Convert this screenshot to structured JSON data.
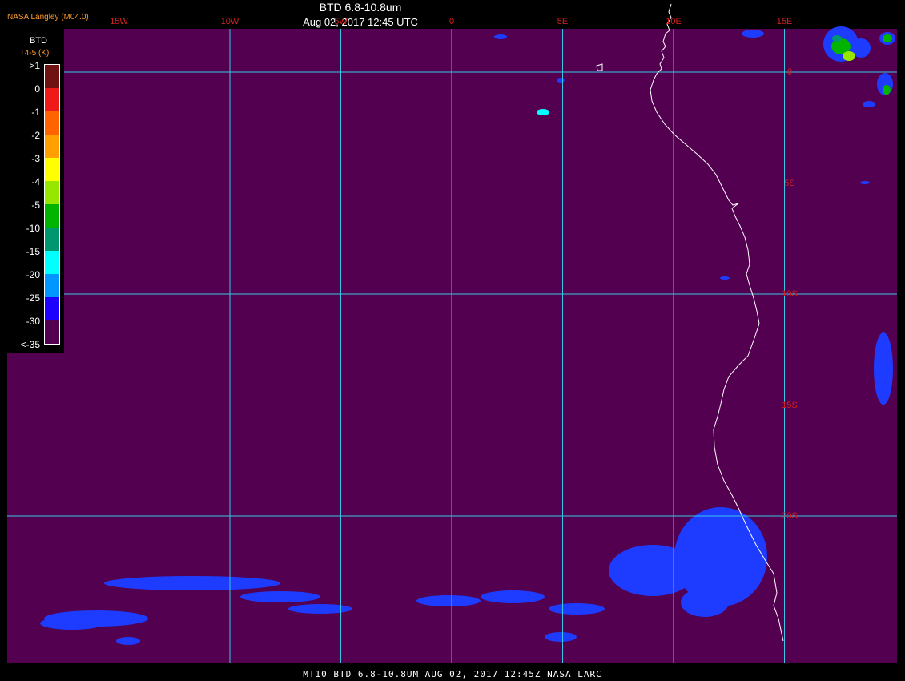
{
  "header": {
    "provider": "NASA Langley (M04.0)",
    "title": "BTD 6.8-10.8um",
    "subtitle": "Aug 02, 2017 12:45 UTC"
  },
  "footer": {
    "text": "MT10  BTD 6.8-10.8UM   AUG 02, 2017 12:45Z   NASA LARC"
  },
  "map": {
    "background_color": "#52004f",
    "grid_color": "#38c8e6",
    "coast_color": "#ffffff",
    "label_color": "#d02020",
    "lon_labels": [
      {
        "label": "15W",
        "value": -15
      },
      {
        "label": "10W",
        "value": -10
      },
      {
        "label": "5W",
        "value": -5
      },
      {
        "label": "0",
        "value": 0
      },
      {
        "label": "5E",
        "value": 5
      },
      {
        "label": "10E",
        "value": 10
      },
      {
        "label": "15E",
        "value": 15
      }
    ],
    "lat_labels": [
      {
        "label": "0",
        "value": 0
      },
      {
        "label": "5S",
        "value": -5
      },
      {
        "label": "10S",
        "value": -10
      },
      {
        "label": "15S",
        "value": -15
      },
      {
        "label": "20S",
        "value": -20
      }
    ]
  },
  "legend": {
    "title": "BTD",
    "units": "T4-5 (K)",
    "ticks": [
      ">1",
      "0",
      "-1",
      "-2",
      "-3",
      "-4",
      "-5",
      "-10",
      "-15",
      "-20",
      "-25",
      "-30",
      "<-35"
    ],
    "colors": [
      "#6e1212",
      "#ee1a1a",
      "#ff6400",
      "#ffa000",
      "#ffff00",
      "#96e600",
      "#00b400",
      "#00966e",
      "#00ffff",
      "#0096ff",
      "#1e00ff",
      "#52004f"
    ]
  },
  "cloud_color": "#1e3cff"
}
